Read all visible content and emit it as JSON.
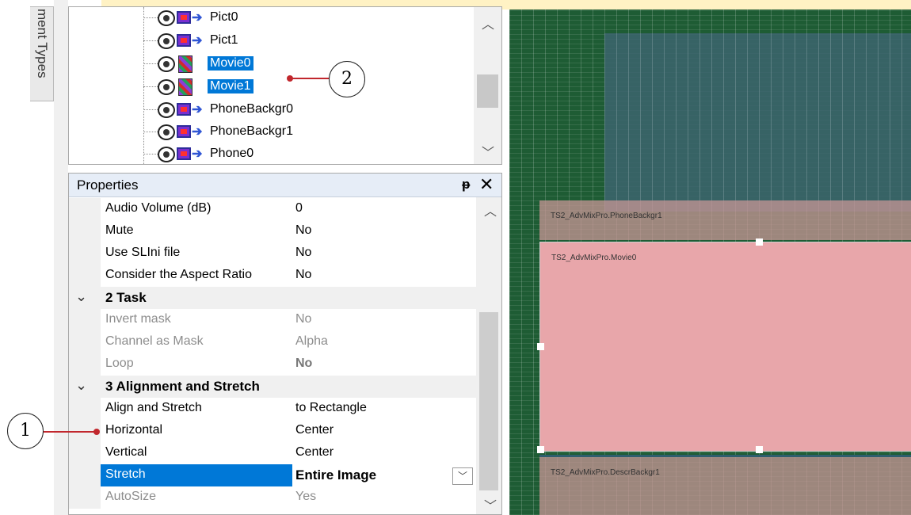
{
  "side_tab": {
    "label": "ment Types"
  },
  "tree": {
    "items": [
      {
        "label": "Pict0",
        "icon": "picture-icon",
        "selected": false
      },
      {
        "label": "Pict1",
        "icon": "picture-icon",
        "selected": false
      },
      {
        "label": "Movie0",
        "icon": "movie-icon",
        "selected": true
      },
      {
        "label": "Movie1",
        "icon": "movie-icon",
        "selected": true
      },
      {
        "label": "PhoneBackgr0",
        "icon": "picture-icon",
        "selected": false
      },
      {
        "label": "PhoneBackgr1",
        "icon": "picture-icon",
        "selected": false
      },
      {
        "label": "Phone0",
        "icon": "picture-icon",
        "selected": false
      }
    ]
  },
  "properties": {
    "title": "Properties",
    "pin_glyph": "ᵽ",
    "close_glyph": "✕",
    "rows": [
      {
        "name": "Audio Volume (dB)",
        "value": "0"
      },
      {
        "name": "Mute",
        "value": "No"
      },
      {
        "name": "Use SLIni file",
        "value": "No"
      },
      {
        "name": "Consider the Aspect Ratio",
        "value": "No"
      },
      {
        "category": "2 Task"
      },
      {
        "name": "Invert mask",
        "value": "No",
        "disabled": true
      },
      {
        "name": "Channel as Mask",
        "value": "Alpha",
        "disabled": true
      },
      {
        "name": "Loop",
        "value": "No",
        "disabled": true
      },
      {
        "category": "3 Alignment and Stretch"
      },
      {
        "name": "Align and Stretch",
        "value": "to Rectangle"
      },
      {
        "name": "Horizontal",
        "value": "Center"
      },
      {
        "name": "Vertical",
        "value": "Center"
      },
      {
        "name": "Stretch",
        "value": "Entire Image",
        "selected": true
      },
      {
        "name": "AutoSize",
        "value": "Yes",
        "disabled": true
      }
    ]
  },
  "canvas": {
    "layers": [
      {
        "label": "TS2_AdvMixPro.PhoneBackgr1"
      },
      {
        "label": "TS2_AdvMixPro.Movie0"
      },
      {
        "label": "TS2_AdvMixPro.DescrBackgr1"
      }
    ]
  },
  "callouts": {
    "one": "1",
    "two": "2"
  },
  "colors": {
    "selection": "#0078d7",
    "callout_line": "#c1272d",
    "canvas_green": "#1e5c34",
    "movie_layer": "#e8a6aa"
  }
}
